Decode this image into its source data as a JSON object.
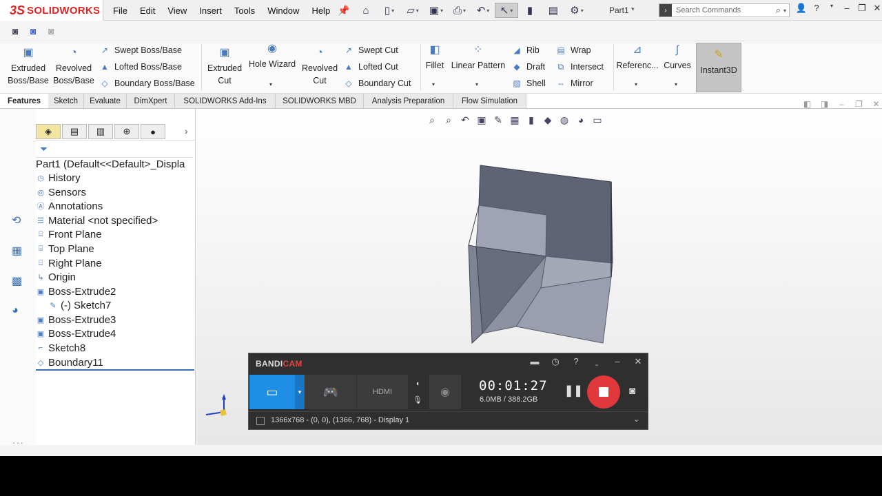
{
  "app": {
    "logo_prefix": "3S",
    "logo_text": "SOLIDWORKS",
    "document_title": "Part1 *"
  },
  "menu": [
    "File",
    "Edit",
    "View",
    "Insert",
    "Tools",
    "Window",
    "Help"
  ],
  "search": {
    "placeholder": "Search Commands"
  },
  "ribbon": {
    "extruded_boss": "Extruded Boss/Base",
    "revolved_boss": "Revolved Boss/Base",
    "swept_boss": "Swept Boss/Base",
    "lofted_boss": "Lofted Boss/Base",
    "boundary_boss": "Boundary Boss/Base",
    "extruded_cut": "Extruded Cut",
    "hole_wizard": "Hole Wizard",
    "revolved_cut": "Revolved Cut",
    "swept_cut": "Swept Cut",
    "lofted_cut": "Lofted Cut",
    "boundary_cut": "Boundary Cut",
    "fillet": "Fillet",
    "linear_pattern": "Linear Pattern",
    "rib": "Rib",
    "draft": "Draft",
    "shell": "Shell",
    "wrap": "Wrap",
    "intersect": "Intersect",
    "mirror": "Mirror",
    "reference": "Referenc...",
    "curves": "Curves",
    "instant3d": "Instant3D"
  },
  "tabs": [
    "Features",
    "Sketch",
    "Evaluate",
    "DimXpert",
    "SOLIDWORKS Add-Ins",
    "SOLIDWORKS MBD",
    "Analysis Preparation",
    "Flow Simulation"
  ],
  "tree": {
    "root": "Part1  (Default<<Default>_Displa",
    "items": [
      "History",
      "Sensors",
      "Annotations",
      "Material <not specified>",
      "Front Plane",
      "Top Plane",
      "Right Plane",
      "Origin",
      "Boss-Extrude2",
      "(-) Sketch7",
      "Boss-Extrude3",
      "Boss-Extrude4",
      "Sketch8",
      "Boundary11"
    ]
  },
  "bandicam": {
    "logo_a": "BANDI",
    "logo_b": "CAM",
    "timer": "00:01:27",
    "size": "6.0MB / 388.2GB",
    "display": "1366x768 - (0, 0), (1366, 768) - Display 1"
  }
}
